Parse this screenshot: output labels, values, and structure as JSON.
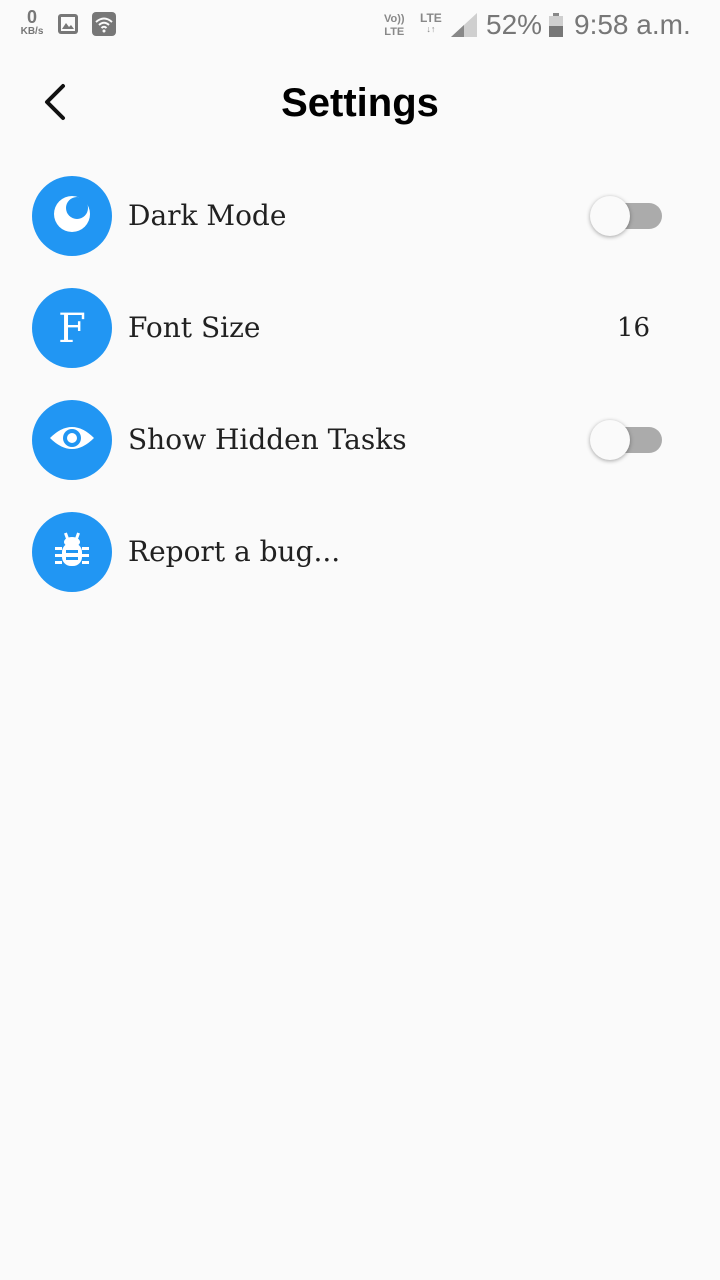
{
  "status_bar": {
    "net_speed_value": "0",
    "net_speed_unit": "KB/s",
    "volte_line1": "Vo))",
    "volte_line2": "LTE",
    "lte_label": "LTE",
    "lte_arrows": "↓↑",
    "battery_percent": "52%",
    "time": "9:58 a.m."
  },
  "header": {
    "title": "Settings",
    "back_icon": "chevron-left-icon"
  },
  "settings": {
    "items": [
      {
        "label": "Dark Mode",
        "icon": "moon-icon",
        "control": "toggle",
        "enabled": false
      },
      {
        "label": "Font Size",
        "icon": "font-icon",
        "icon_glyph": "F",
        "control": "value",
        "value": "16"
      },
      {
        "label": "Show Hidden Tasks",
        "icon": "eye-icon",
        "control": "toggle",
        "enabled": false
      },
      {
        "label": "Report a bug...",
        "icon": "bug-icon",
        "control": "none"
      }
    ]
  },
  "colors": {
    "accent": "#2196f3",
    "background": "#fafafa",
    "toggle_off_track": "#ababab"
  }
}
